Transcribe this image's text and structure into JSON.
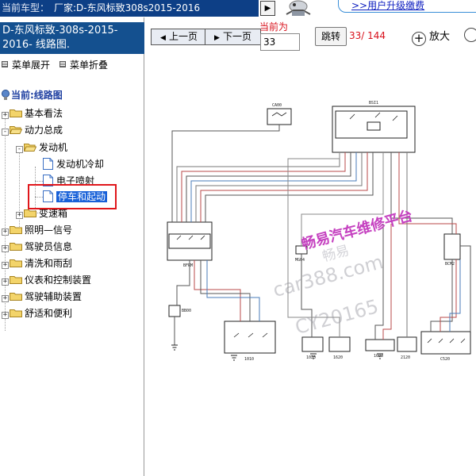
{
  "header": {
    "vehicle_label": "当前车型：",
    "vehicle_value": "厂家:D-东风标致308s2015-2016",
    "upgrade_link": ">>用户升级缴费",
    "arrow_glyph": "▶"
  },
  "sidebar": {
    "title": "D-东风标致-308s-2015-2016- 线路图.",
    "expand_all": "菜单展开",
    "collapse_all": "菜单折叠",
    "current": "当前:线路图",
    "tree": [
      {
        "label": "基本看法",
        "type": "folder",
        "expanded": false
      },
      {
        "label": "动力总成",
        "type": "folder",
        "expanded": true
      },
      {
        "label": "发动机",
        "type": "folder",
        "expanded": true
      },
      {
        "label": "发动机冷却",
        "type": "page"
      },
      {
        "label": "电子喷射",
        "type": "page"
      },
      {
        "label": "停车和起动",
        "type": "page",
        "selected": true
      },
      {
        "label": "变速箱",
        "type": "folder",
        "expanded": false
      },
      {
        "label": "照明—信号",
        "type": "folder",
        "expanded": false
      },
      {
        "label": "驾驶员信息",
        "type": "folder",
        "expanded": false
      },
      {
        "label": "清洗和雨刮",
        "type": "folder",
        "expanded": false
      },
      {
        "label": "仪表和控制装置",
        "type": "folder",
        "expanded": false
      },
      {
        "label": "驾驶辅助装置",
        "type": "folder",
        "expanded": false
      },
      {
        "label": "舒适和便利",
        "type": "folder",
        "expanded": false
      }
    ]
  },
  "toolbar": {
    "prev_label": "上一页",
    "next_label": "下一页",
    "current_label": "当前为",
    "page_value": "33",
    "jump_label": "跳转",
    "page_count": "33/ 144",
    "zoom_in_label": "放大"
  },
  "diagram": {
    "component_labels": [
      "CA00",
      "BSI1",
      "BFRM",
      "MG04",
      "BCM2",
      "BB00",
      "1010",
      "1020",
      "1620",
      "1604",
      "2120",
      "C520"
    ],
    "watermark_brand": "畅易汽车维修平台",
    "watermark_sub": "畅易",
    "watermark_url": "car388.com",
    "watermark_id": "CY20165"
  },
  "colors": {
    "header_bg": "#0d3f86",
    "sidebar_title_bg": "#14508f",
    "selected_bg": "#1760d8",
    "highlight_border": "#e0161b",
    "accent_red": "#d8101b",
    "watermark_brand": "#c541c0"
  }
}
